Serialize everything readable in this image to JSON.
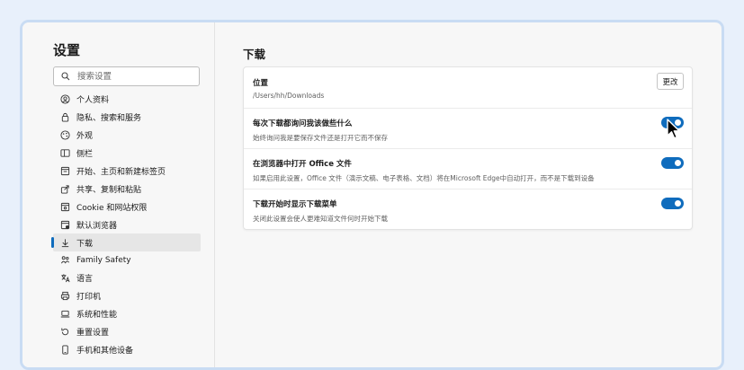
{
  "sidebar": {
    "title": "设置",
    "search_placeholder": "搜索设置",
    "items": [
      {
        "label": "个人资料",
        "icon": "profile-icon"
      },
      {
        "label": "隐私、搜索和服务",
        "icon": "lock-icon"
      },
      {
        "label": "外观",
        "icon": "appearance-icon"
      },
      {
        "label": "侧栏",
        "icon": "sidebar-icon"
      },
      {
        "label": "开始、主页和新建标签页",
        "icon": "home-icon"
      },
      {
        "label": "共享、复制和粘贴",
        "icon": "share-icon"
      },
      {
        "label": "Cookie 和网站权限",
        "icon": "cookie-icon"
      },
      {
        "label": "默认浏览器",
        "icon": "browser-icon"
      },
      {
        "label": "下载",
        "icon": "download-icon",
        "active": true
      },
      {
        "label": "Family Safety",
        "icon": "family-icon"
      },
      {
        "label": "语言",
        "icon": "language-icon"
      },
      {
        "label": "打印机",
        "icon": "printer-icon"
      },
      {
        "label": "系统和性能",
        "icon": "laptop-icon"
      },
      {
        "label": "重置设置",
        "icon": "reset-icon"
      },
      {
        "label": "手机和其他设备",
        "icon": "phone-icon"
      }
    ]
  },
  "main": {
    "title": "下载",
    "location": {
      "label": "位置",
      "path": "/Users/hh/Downloads",
      "button": "更改"
    },
    "settings": [
      {
        "label": "每次下载都询问我该做些什么",
        "desc": "始终询问我是要保存文件还是打开它而不保存",
        "on": true
      },
      {
        "label": "在浏览器中打开 Office 文件",
        "desc": "如果启用此设置，Office 文件（演示文稿、电子表格、文档）将在Microsoft Edge中自动打开，而不是下载到设备",
        "on": true
      },
      {
        "label": "下载开始时显示下载菜单",
        "desc": "关闭此设置会使人更难知道文件何时开始下载",
        "on": true
      }
    ]
  },
  "colors": {
    "accent": "#0f6cbd",
    "background": "#e8f0fb"
  }
}
